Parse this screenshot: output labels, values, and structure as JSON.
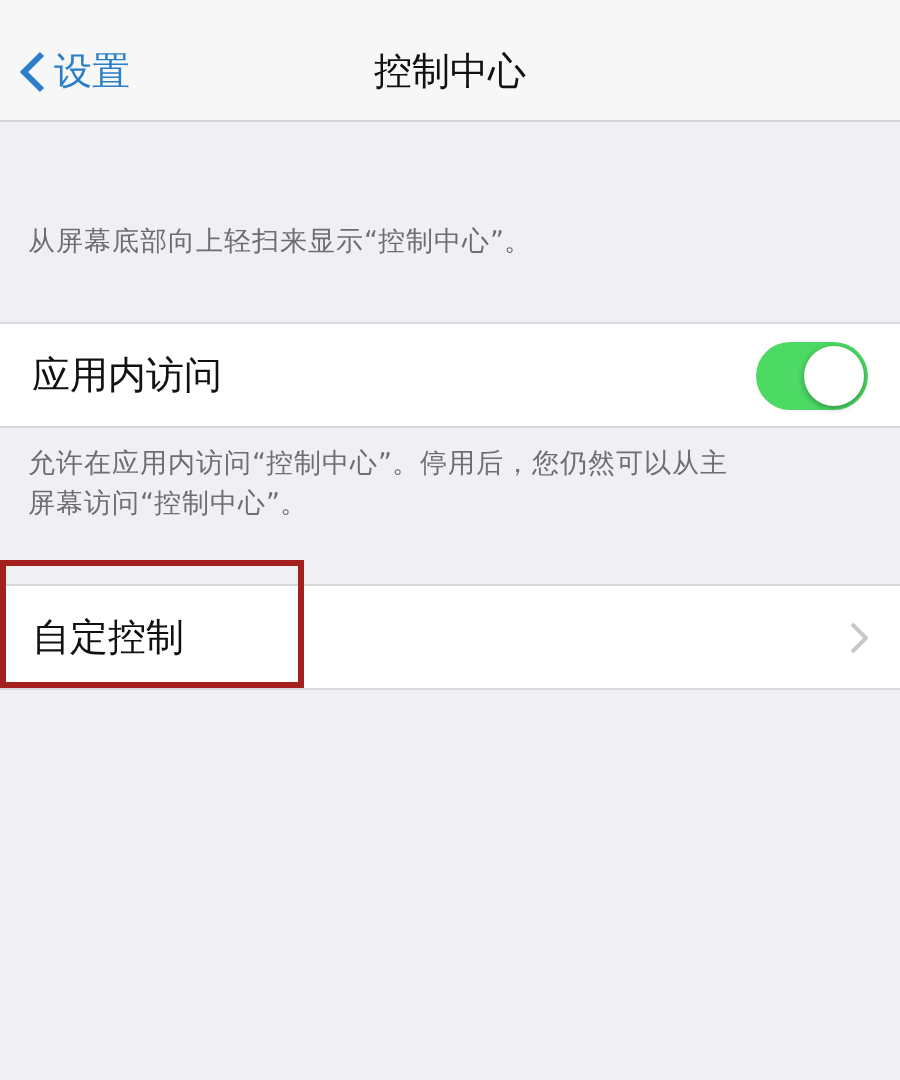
{
  "nav": {
    "back": "设置",
    "title": "控制中心"
  },
  "header_note": "从屏幕底部向上轻扫来显示“控制中心”。",
  "access_row": {
    "label": "应用内访问",
    "on": true
  },
  "access_note": "允许在应用内访问“控制中心”。停用后，您仍然可以从主屏幕访问“控制中心”。",
  "customize_row": {
    "label": "自定控制",
    "highlighted": true
  }
}
